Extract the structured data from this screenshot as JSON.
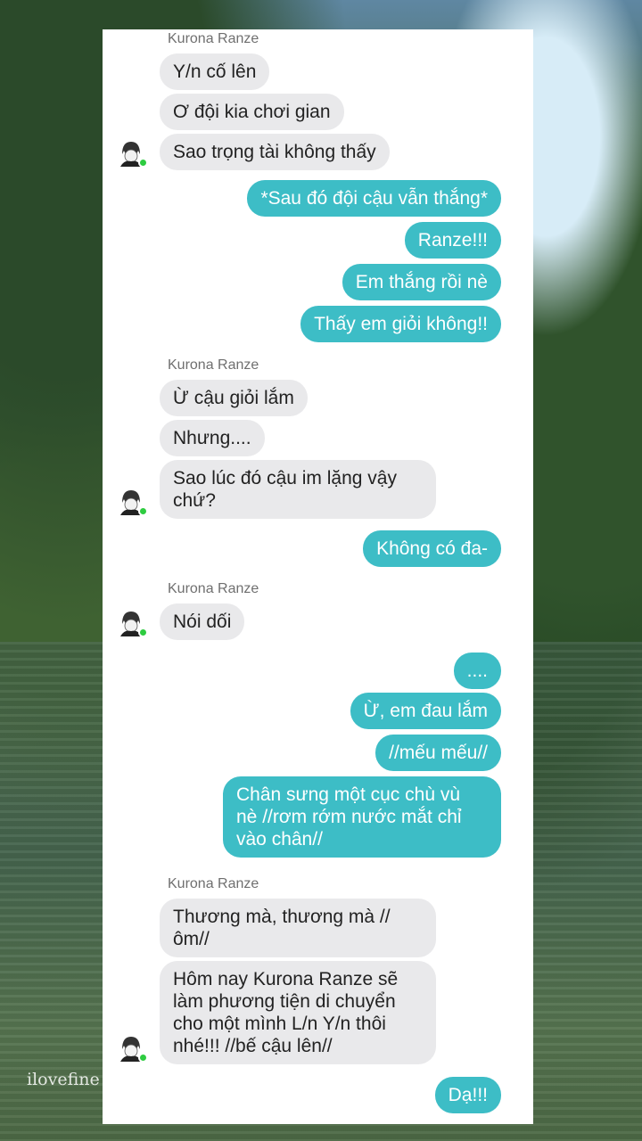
{
  "watermark": "ilovefine",
  "contact": {
    "name": "Kurona Ranze"
  },
  "colors": {
    "outgoing": "#3dbdc6",
    "incoming": "#e9e9eb"
  },
  "messages": {
    "g1": [
      "Y/n cố lên",
      "Ơ đội kia chơi gian",
      "Sao trọng tài không thấy"
    ],
    "o1": [
      "*Sau đó đội cậu vẫn thắng*",
      "Ranze!!!",
      "Em thắng rồi nè",
      "Thấy em giỏi không!!"
    ],
    "g2": [
      "Ừ cậu giỏi lắm",
      "Nhưng....",
      "Sao lúc đó cậu im lặng vậy\nchứ?"
    ],
    "o2": [
      "Không có đa-"
    ],
    "g3": [
      "Nói dối"
    ],
    "o3": [
      "....",
      "Ừ, em đau lắm",
      "//mếu mếu//",
      "Chân sưng một cục chù vù\nnè //rơm rớm nước mắt chỉ\nvào chân//"
    ],
    "g4": [
      "Thương mà, thương mà //\nôm//",
      "Hôm nay Kurona Ranze sẽ\nlàm phương tiện di chuyển\ncho một mình L/n Y/n thôi\nnhé!!! //bế cậu lên//"
    ],
    "o4": [
      "Dạ!!!"
    ]
  }
}
